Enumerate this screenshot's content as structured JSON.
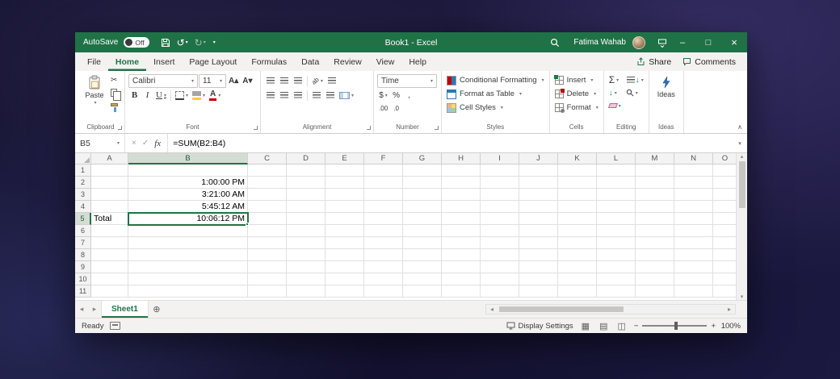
{
  "titlebar": {
    "autosave_label": "AutoSave",
    "autosave_state": "Off",
    "title": "Book1 - Excel",
    "user_name": "Fatima Wahab"
  },
  "tabs": {
    "items": [
      "File",
      "Home",
      "Insert",
      "Page Layout",
      "Formulas",
      "Data",
      "Review",
      "View",
      "Help"
    ],
    "active": "Home",
    "share": "Share",
    "comments": "Comments"
  },
  "ribbon": {
    "clipboard": {
      "group": "Clipboard",
      "paste": "Paste"
    },
    "font": {
      "group": "Font",
      "family": "Calibri",
      "size": "11",
      "bold": "B",
      "italic": "I",
      "underline": "U"
    },
    "alignment": {
      "group": "Alignment",
      "orientation": "ab"
    },
    "number": {
      "group": "Number",
      "format": "Time",
      "currency": "$",
      "percent": "%",
      "comma": ",",
      "inc_decimal": ".00",
      "dec_decimal": ".0"
    },
    "styles": {
      "group": "Styles",
      "conditional": "Conditional Formatting",
      "table": "Format as Table",
      "cellstyles": "Cell Styles"
    },
    "cells": {
      "group": "Cells",
      "insert": "Insert",
      "delete": "Delete",
      "format": "Format"
    },
    "editing": {
      "group": "Editing"
    },
    "ideas": {
      "group": "Ideas",
      "button": "Ideas"
    }
  },
  "formula_bar": {
    "name_box": "B5",
    "fx": "fx",
    "formula": "=SUM(B2:B4)"
  },
  "grid": {
    "columns": [
      "A",
      "B",
      "C",
      "D",
      "E",
      "F",
      "G",
      "H",
      "I",
      "J",
      "K",
      "L",
      "M",
      "N",
      "O"
    ],
    "rows": [
      "1",
      "2",
      "3",
      "4",
      "5",
      "6",
      "7",
      "8",
      "9",
      "10",
      "11"
    ],
    "cells": {
      "B2": "1:00:00 PM",
      "B3": "3:21:00 AM",
      "B4": "5:45:12 AM",
      "A5": "Total",
      "B5": "10:06:12 PM"
    },
    "selected": "B5",
    "selected_col": "B",
    "selected_row": "5"
  },
  "sheets": {
    "active": "Sheet1"
  },
  "statusbar": {
    "mode": "Ready",
    "display_settings": "Display Settings",
    "zoom": "100%"
  },
  "icons": {
    "cut": "✂",
    "undo": "↺",
    "redo": "↻",
    "minimize": "–",
    "maximize": "□",
    "close": "×",
    "cancel": "×",
    "check": "✓",
    "add_sheet": "⊕",
    "sheet_nav_left": "◂",
    "sheet_nav_right": "▸",
    "hscroll_left": "◂",
    "hscroll_right": "▸",
    "vscroll_up": "▴",
    "vscroll_down": "▾",
    "collapse_ribbon": "∧",
    "autosum": "Σ",
    "fill_down": "↓",
    "sort_down": "↓",
    "increase_font": "A▴",
    "decrease_font": "A▾",
    "view_normal": "▦",
    "view_page_layout": "▤",
    "view_page_break": "◫",
    "zoom_out": "−",
    "zoom_in": "+"
  },
  "colors": {
    "excel_green": "#217346",
    "titlebar_green": "#1f7245",
    "selection_border": "#217346",
    "font_color_bar": "#c00000",
    "fill_color_bar": "#ffc83d"
  }
}
